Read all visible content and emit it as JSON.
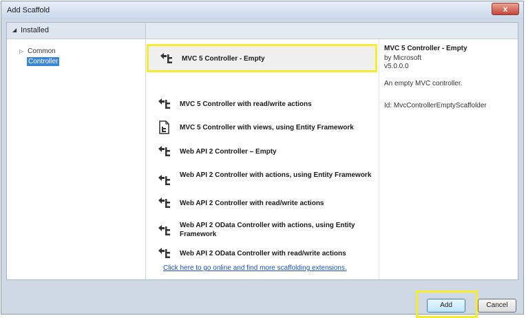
{
  "window": {
    "title": "Add Scaffold",
    "close_label": "x"
  },
  "tree": {
    "header_label": "Installed",
    "items": [
      {
        "label": "Common"
      },
      {
        "label": "Controller"
      }
    ]
  },
  "scaffolds": [
    {
      "label": "MVC 5 Controller - Empty",
      "icon": "controller-icon",
      "selected": true
    },
    {
      "label": "MVC 5 Controller with read/write actions",
      "icon": "controller-icon"
    },
    {
      "label": "MVC 5 Controller with views, using Entity Framework",
      "icon": "document-icon"
    },
    {
      "label": "Web API 2 Controller – Empty",
      "icon": "controller-icon"
    },
    {
      "label": "Web API 2 Controller with actions, using Entity Framework",
      "icon": "controller-icon"
    },
    {
      "label": "Web API 2 Controller with read/write actions",
      "icon": "controller-icon"
    },
    {
      "label": "Web API 2 OData Controller with actions, using Entity Framework",
      "icon": "controller-icon"
    },
    {
      "label": "Web API 2 OData Controller with read/write actions",
      "icon": "controller-icon"
    }
  ],
  "online_link": "Click here to go online and find more scaffolding extensions.",
  "details": {
    "title": "MVC 5 Controller - Empty",
    "author": "by Microsoft",
    "version": "v5.0.0.0",
    "description": "An empty MVC controller.",
    "id": "Id: MvcControllerEmptyScaffolder"
  },
  "buttons": {
    "add": "Add",
    "cancel": "Cancel"
  },
  "colors": {
    "highlight": "#f6eb2c",
    "selection": "#3c86d6",
    "link": "#1a4fc0"
  }
}
